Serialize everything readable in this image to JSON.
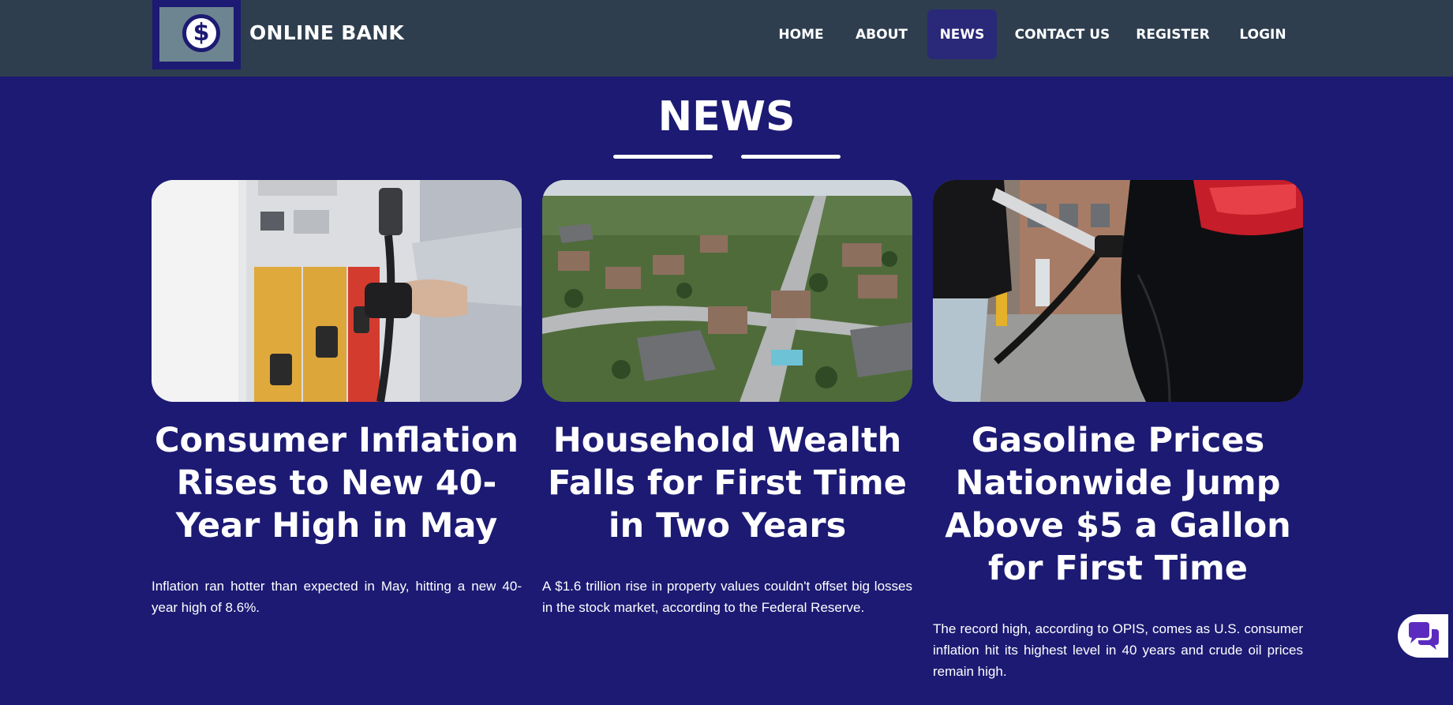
{
  "header": {
    "brand": "ONLINE BANK",
    "logo_symbol": "$",
    "nav": [
      {
        "label": "HOME"
      },
      {
        "label": "ABOUT"
      },
      {
        "label": "NEWS",
        "active": true
      },
      {
        "label": "CONTACT US"
      },
      {
        "label": "REGISTER"
      },
      {
        "label": "LOGIN"
      }
    ]
  },
  "page": {
    "title": "NEWS"
  },
  "cards": [
    {
      "image": "gas-pump-photo",
      "title": "Consumer Inflation Rises to New 40-Year High in May",
      "description": "Inflation ran hotter than expected in May, hitting a new 40-year high of 8.6%."
    },
    {
      "image": "suburban-houses-aerial-photo",
      "title": "Household Wealth Falls for First Time in Two Years",
      "description": "A $1.6 trillion rise in property values couldn't offset big losses in the stock market, according to the Federal Reserve."
    },
    {
      "image": "car-refueling-photo",
      "title": "Gasoline Prices Nationwide Jump Above $5 a Gallon for First Time",
      "description": "The record high, according to OPIS, comes as U.S. consumer inflation hit its highest level in 40 years and crude oil prices remain high."
    }
  ],
  "chat_widget": {
    "icon": "chat-bubbles-icon"
  },
  "colors": {
    "page_background": "#1c1a73",
    "header_background": "#2e3e4f",
    "active_nav": "#2a2879",
    "chat_icon": "#5b2bbf"
  }
}
